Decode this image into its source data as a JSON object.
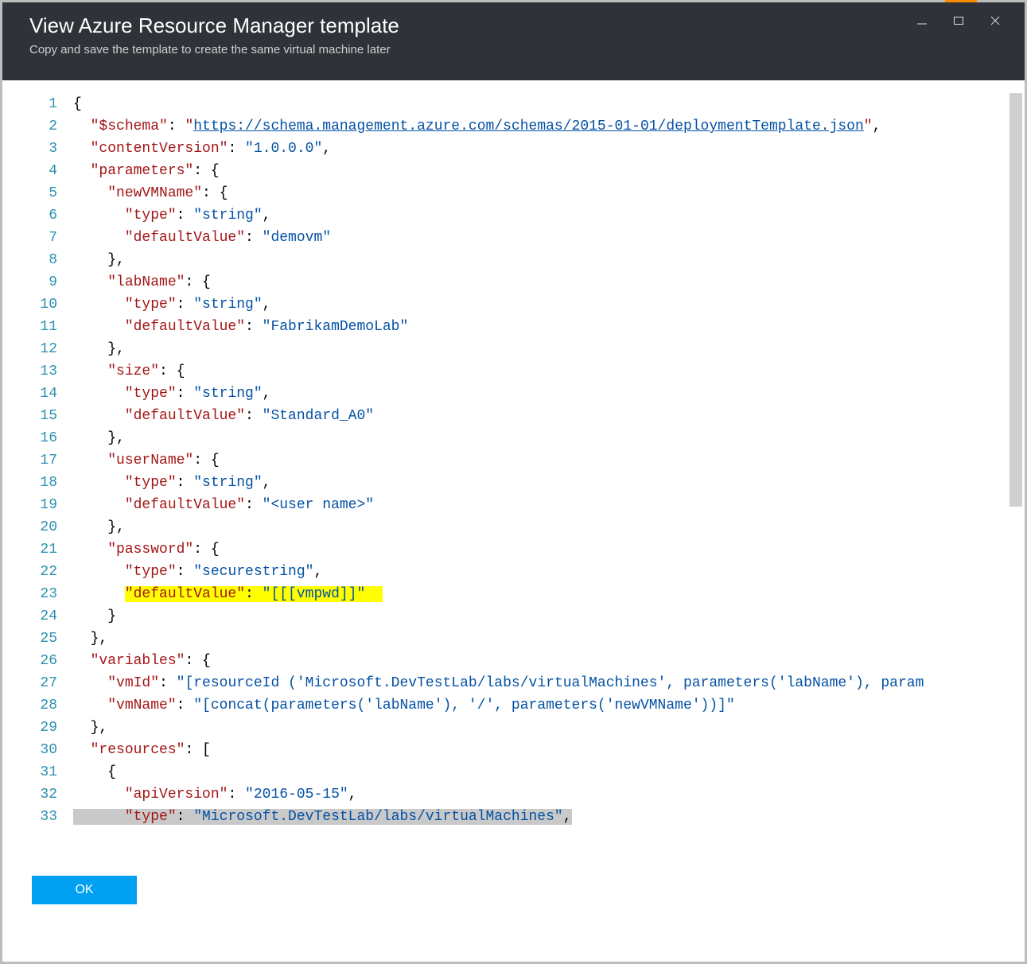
{
  "header": {
    "title": "View Azure Resource Manager template",
    "subtitle": "Copy and save the template to create the same virtual machine later"
  },
  "footer": {
    "ok_label": "OK"
  },
  "code": {
    "lines": [
      {
        "n": 1,
        "indent": 0,
        "tokens": [
          {
            "t": "txt",
            "v": "{"
          }
        ]
      },
      {
        "n": 2,
        "indent": 1,
        "tokens": [
          {
            "t": "key",
            "v": "\"$schema\""
          },
          {
            "t": "txt",
            "v": ": "
          },
          {
            "t": "key",
            "v": "\""
          },
          {
            "t": "url",
            "v": "https://schema.management.azure.com/schemas/2015-01-01/deploymentTemplate.json"
          },
          {
            "t": "key",
            "v": "\""
          },
          {
            "t": "txt",
            "v": ","
          }
        ]
      },
      {
        "n": 3,
        "indent": 1,
        "tokens": [
          {
            "t": "key",
            "v": "\"contentVersion\""
          },
          {
            "t": "txt",
            "v": ": "
          },
          {
            "t": "str",
            "v": "\"1.0.0.0\""
          },
          {
            "t": "txt",
            "v": ","
          }
        ]
      },
      {
        "n": 4,
        "indent": 1,
        "tokens": [
          {
            "t": "key",
            "v": "\"parameters\""
          },
          {
            "t": "txt",
            "v": ": {"
          }
        ]
      },
      {
        "n": 5,
        "indent": 2,
        "tokens": [
          {
            "t": "key",
            "v": "\"newVMName\""
          },
          {
            "t": "txt",
            "v": ": {"
          }
        ]
      },
      {
        "n": 6,
        "indent": 3,
        "tokens": [
          {
            "t": "key",
            "v": "\"type\""
          },
          {
            "t": "txt",
            "v": ": "
          },
          {
            "t": "str",
            "v": "\"string\""
          },
          {
            "t": "txt",
            "v": ","
          }
        ]
      },
      {
        "n": 7,
        "indent": 3,
        "tokens": [
          {
            "t": "key",
            "v": "\"defaultValue\""
          },
          {
            "t": "txt",
            "v": ": "
          },
          {
            "t": "str",
            "v": "\"demovm\""
          }
        ]
      },
      {
        "n": 8,
        "indent": 2,
        "tokens": [
          {
            "t": "txt",
            "v": "},"
          }
        ]
      },
      {
        "n": 9,
        "indent": 2,
        "tokens": [
          {
            "t": "key",
            "v": "\"labName\""
          },
          {
            "t": "txt",
            "v": ": {"
          }
        ]
      },
      {
        "n": 10,
        "indent": 3,
        "tokens": [
          {
            "t": "key",
            "v": "\"type\""
          },
          {
            "t": "txt",
            "v": ": "
          },
          {
            "t": "str",
            "v": "\"string\""
          },
          {
            "t": "txt",
            "v": ","
          }
        ]
      },
      {
        "n": 11,
        "indent": 3,
        "tokens": [
          {
            "t": "key",
            "v": "\"defaultValue\""
          },
          {
            "t": "txt",
            "v": ": "
          },
          {
            "t": "str",
            "v": "\"FabrikamDemoLab\""
          }
        ]
      },
      {
        "n": 12,
        "indent": 2,
        "tokens": [
          {
            "t": "txt",
            "v": "},"
          }
        ]
      },
      {
        "n": 13,
        "indent": 2,
        "tokens": [
          {
            "t": "key",
            "v": "\"size\""
          },
          {
            "t": "txt",
            "v": ": {"
          }
        ]
      },
      {
        "n": 14,
        "indent": 3,
        "tokens": [
          {
            "t": "key",
            "v": "\"type\""
          },
          {
            "t": "txt",
            "v": ": "
          },
          {
            "t": "str",
            "v": "\"string\""
          },
          {
            "t": "txt",
            "v": ","
          }
        ]
      },
      {
        "n": 15,
        "indent": 3,
        "tokens": [
          {
            "t": "key",
            "v": "\"defaultValue\""
          },
          {
            "t": "txt",
            "v": ": "
          },
          {
            "t": "str",
            "v": "\"Standard_A0\""
          }
        ]
      },
      {
        "n": 16,
        "indent": 2,
        "tokens": [
          {
            "t": "txt",
            "v": "},"
          }
        ]
      },
      {
        "n": 17,
        "indent": 2,
        "tokens": [
          {
            "t": "key",
            "v": "\"userName\""
          },
          {
            "t": "txt",
            "v": ": {"
          }
        ]
      },
      {
        "n": 18,
        "indent": 3,
        "tokens": [
          {
            "t": "key",
            "v": "\"type\""
          },
          {
            "t": "txt",
            "v": ": "
          },
          {
            "t": "str",
            "v": "\"string\""
          },
          {
            "t": "txt",
            "v": ","
          }
        ]
      },
      {
        "n": 19,
        "indent": 3,
        "tokens": [
          {
            "t": "key",
            "v": "\"defaultValue\""
          },
          {
            "t": "txt",
            "v": ": "
          },
          {
            "t": "str",
            "v": "\"<user name>\""
          }
        ]
      },
      {
        "n": 20,
        "indent": 2,
        "tokens": [
          {
            "t": "txt",
            "v": "},"
          }
        ]
      },
      {
        "n": 21,
        "indent": 2,
        "tokens": [
          {
            "t": "key",
            "v": "\"password\""
          },
          {
            "t": "txt",
            "v": ": {"
          }
        ]
      },
      {
        "n": 22,
        "indent": 3,
        "tokens": [
          {
            "t": "key",
            "v": "\"type\""
          },
          {
            "t": "txt",
            "v": ": "
          },
          {
            "t": "str",
            "v": "\"securestring\""
          },
          {
            "t": "txt",
            "v": ","
          }
        ]
      },
      {
        "n": 23,
        "indent": 3,
        "hl": true,
        "tokens": [
          {
            "t": "key",
            "v": "\"defaultValue\""
          },
          {
            "t": "txt",
            "v": ": "
          },
          {
            "t": "str",
            "v": "\"[[[vmpwd]]\""
          }
        ]
      },
      {
        "n": 24,
        "indent": 2,
        "tokens": [
          {
            "t": "txt",
            "v": "}"
          }
        ]
      },
      {
        "n": 25,
        "indent": 1,
        "tokens": [
          {
            "t": "txt",
            "v": "},"
          }
        ]
      },
      {
        "n": 26,
        "indent": 1,
        "tokens": [
          {
            "t": "key",
            "v": "\"variables\""
          },
          {
            "t": "txt",
            "v": ": {"
          }
        ]
      },
      {
        "n": 27,
        "indent": 2,
        "tokens": [
          {
            "t": "key",
            "v": "\"vmId\""
          },
          {
            "t": "txt",
            "v": ": "
          },
          {
            "t": "str",
            "v": "\"[resourceId ('Microsoft.DevTestLab/labs/virtualMachines', parameters('labName'), param"
          }
        ]
      },
      {
        "n": 28,
        "indent": 2,
        "tokens": [
          {
            "t": "key",
            "v": "\"vmName\""
          },
          {
            "t": "txt",
            "v": ": "
          },
          {
            "t": "str",
            "v": "\"[concat(parameters('labName'), '/', parameters('newVMName'))]\""
          }
        ]
      },
      {
        "n": 29,
        "indent": 1,
        "tokens": [
          {
            "t": "txt",
            "v": "},"
          }
        ]
      },
      {
        "n": 30,
        "indent": 1,
        "tokens": [
          {
            "t": "key",
            "v": "\"resources\""
          },
          {
            "t": "txt",
            "v": ": ["
          }
        ]
      },
      {
        "n": 31,
        "indent": 2,
        "tokens": [
          {
            "t": "txt",
            "v": "{"
          }
        ]
      },
      {
        "n": 32,
        "indent": 3,
        "tokens": [
          {
            "t": "key",
            "v": "\"apiVersion\""
          },
          {
            "t": "txt",
            "v": ": "
          },
          {
            "t": "str",
            "v": "\"2016-05-15\""
          },
          {
            "t": "txt",
            "v": ","
          }
        ]
      },
      {
        "n": 33,
        "indent": 3,
        "sel": true,
        "tokens": [
          {
            "t": "key",
            "v": "\"type\""
          },
          {
            "t": "txt",
            "v": ": "
          },
          {
            "t": "str",
            "v": "\"Microsoft.DevTestLab/labs/virtualMachines\""
          },
          {
            "t": "txt",
            "v": ","
          }
        ]
      }
    ]
  }
}
